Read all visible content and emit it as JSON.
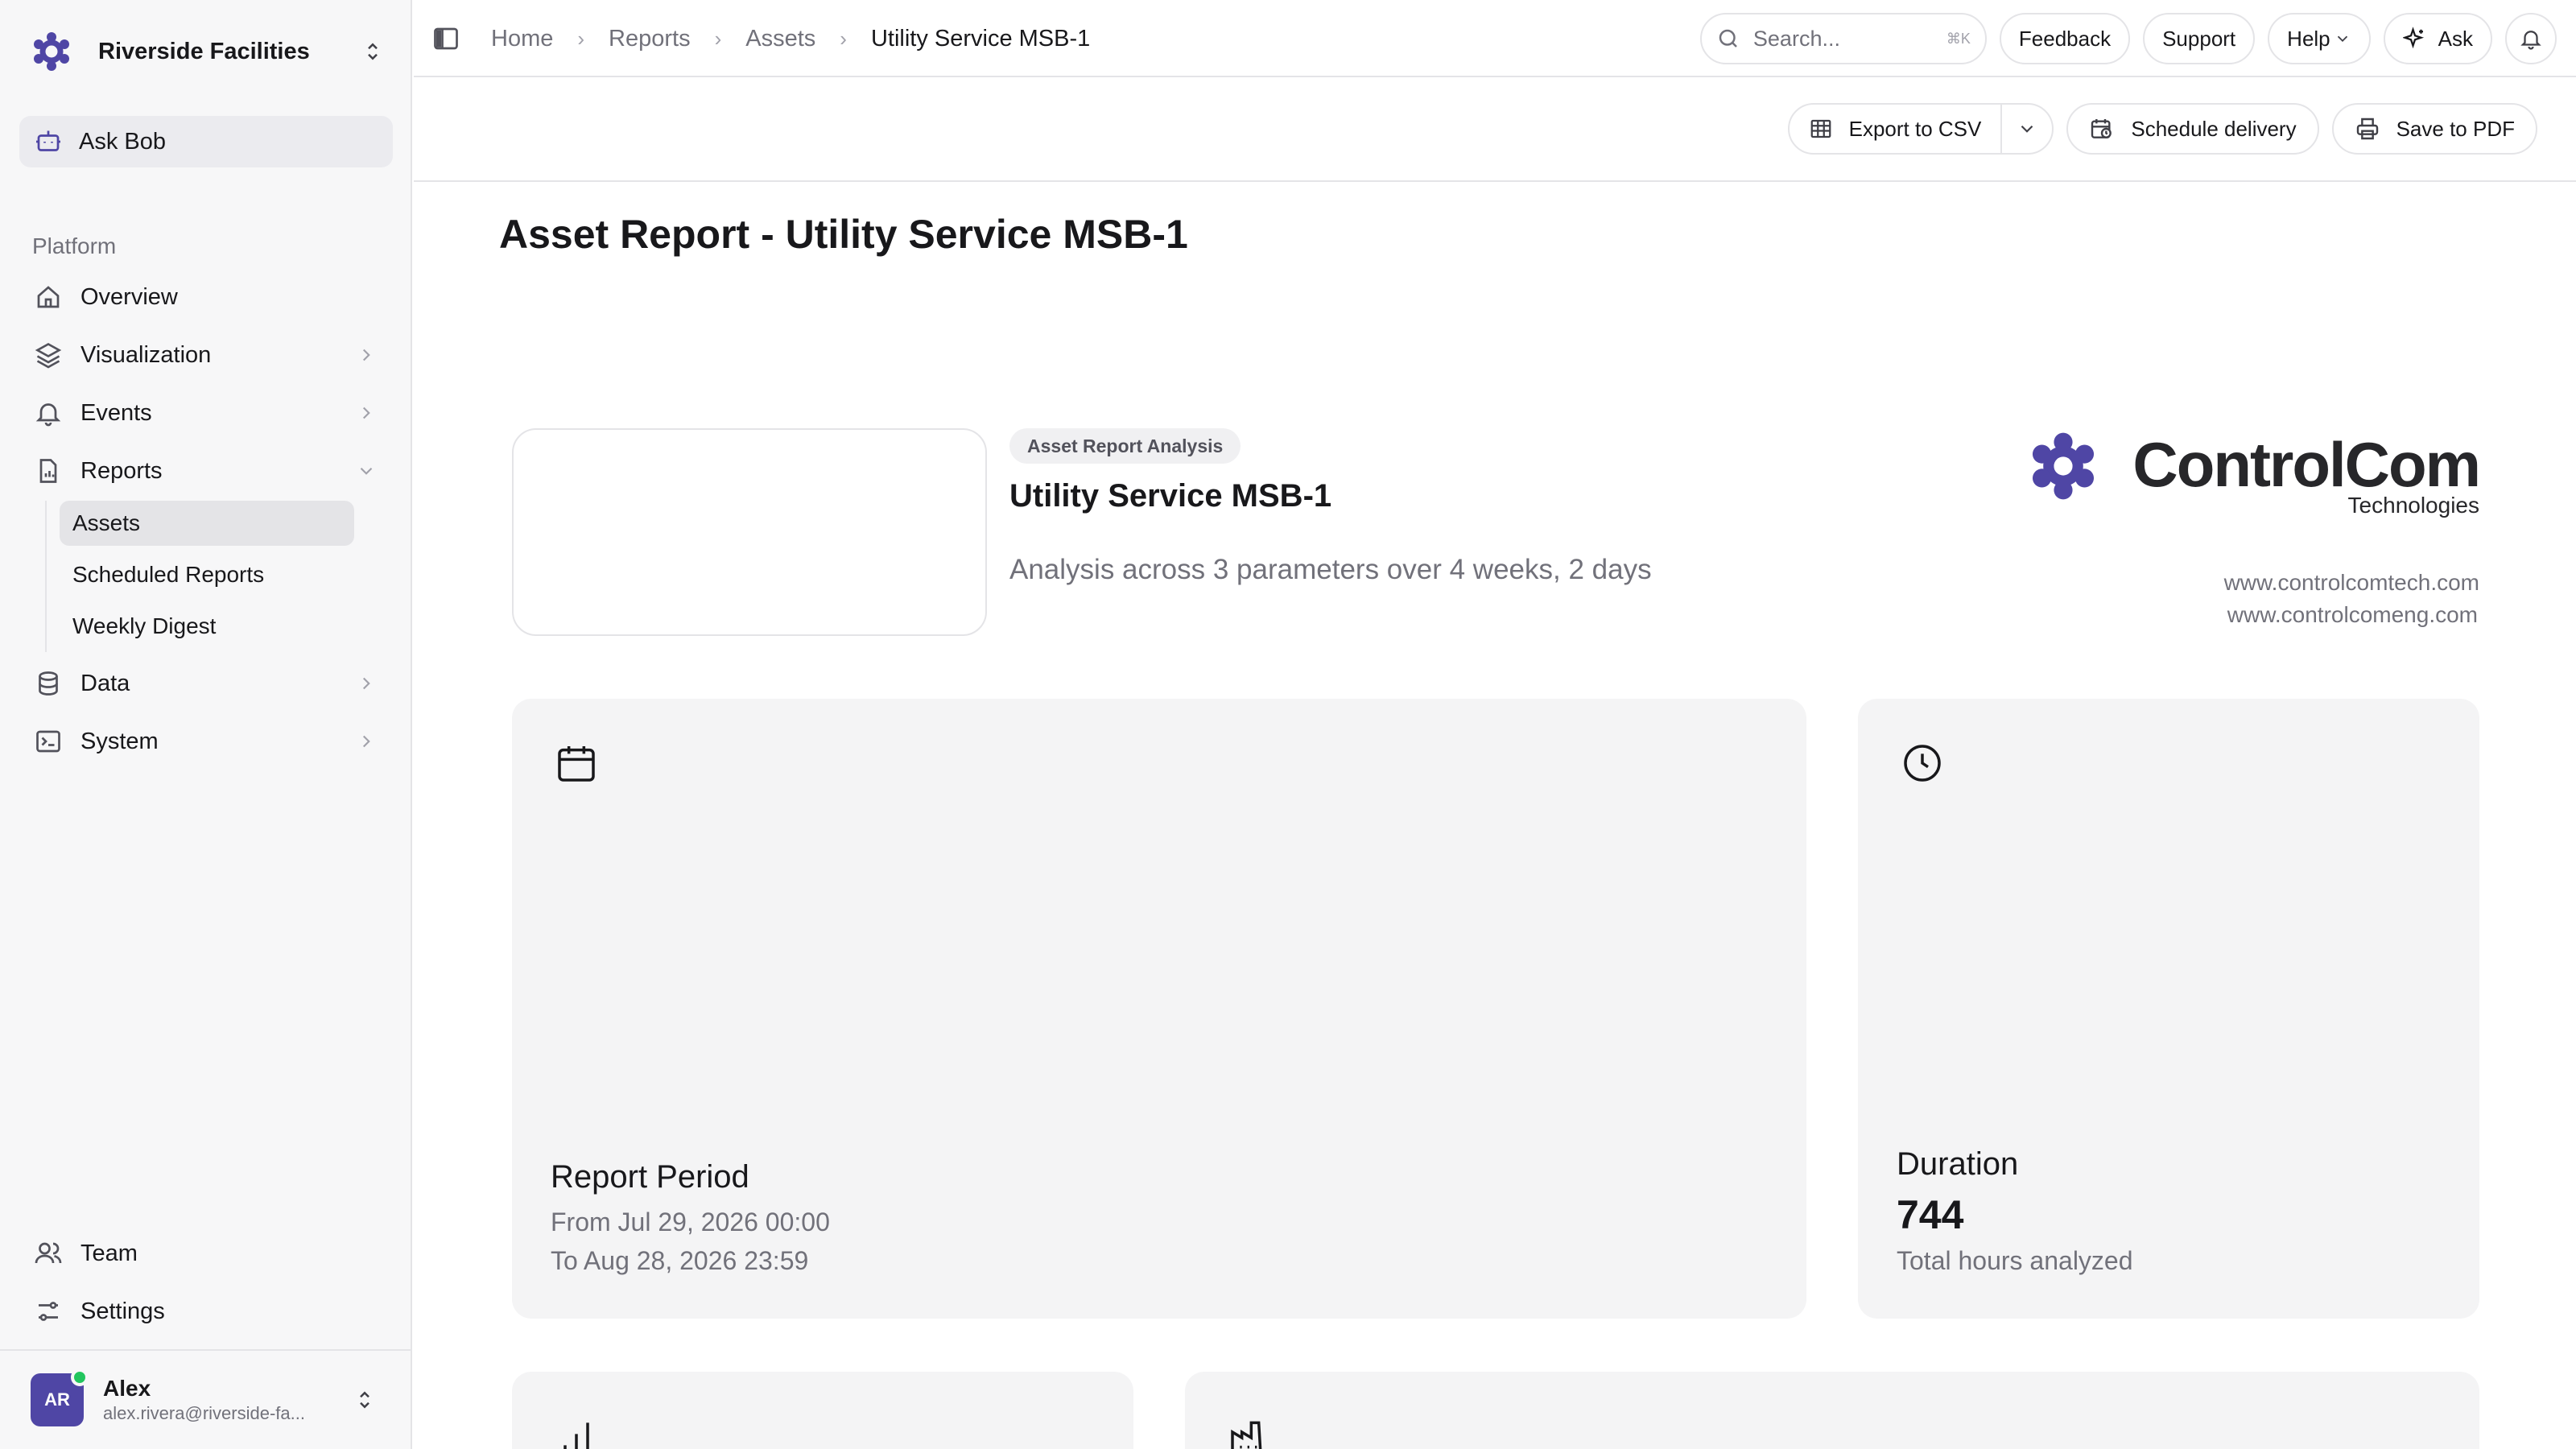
{
  "sidebar": {
    "org_name": "Riverside Facilities",
    "ask_label": "Ask Bob",
    "section": "Platform",
    "items": [
      {
        "label": "Overview"
      },
      {
        "label": "Visualization"
      },
      {
        "label": "Events"
      },
      {
        "label": "Reports"
      },
      {
        "label": "Data"
      },
      {
        "label": "System"
      }
    ],
    "reports_sub": [
      {
        "label": "Assets"
      },
      {
        "label": "Scheduled Reports"
      },
      {
        "label": "Weekly Digest"
      }
    ],
    "bottom": [
      {
        "label": "Team"
      },
      {
        "label": "Settings"
      }
    ],
    "user": {
      "initials": "AR",
      "name": "Alex",
      "email": "alex.rivera@riverside-fa..."
    }
  },
  "topbar": {
    "breadcrumb": [
      "Home",
      "Reports",
      "Assets",
      "Utility Service MSB-1"
    ],
    "search_placeholder": "Search...",
    "search_shortcut": "⌘K",
    "feedback": "Feedback",
    "support": "Support",
    "help": "Help",
    "ask": "Ask"
  },
  "actions": {
    "export": "Export to CSV",
    "schedule": "Schedule delivery",
    "pdf": "Save to PDF"
  },
  "report": {
    "page_title": "Asset Report - Utility Service MSB-1",
    "badge": "Asset Report Analysis",
    "asset_name": "Utility Service MSB-1",
    "subtitle": "Analysis across 3 parameters over 4 weeks, 2 days",
    "brand_name": "ControlCom",
    "brand_tag": "Technologies",
    "url1": "www.controlcomtech.com",
    "url2": "www.controlcomeng.com",
    "period": {
      "title": "Report Period",
      "from": "From Jul 29, 2026 00:00",
      "to": "To Aug 28, 2026 23:59"
    },
    "duration": {
      "title": "Duration",
      "value": "744",
      "caption": "Total hours analyzed"
    }
  },
  "colors": {
    "brand": "#4f46a5",
    "accent_bg": "#f4f4f5",
    "online": "#22c55e"
  }
}
